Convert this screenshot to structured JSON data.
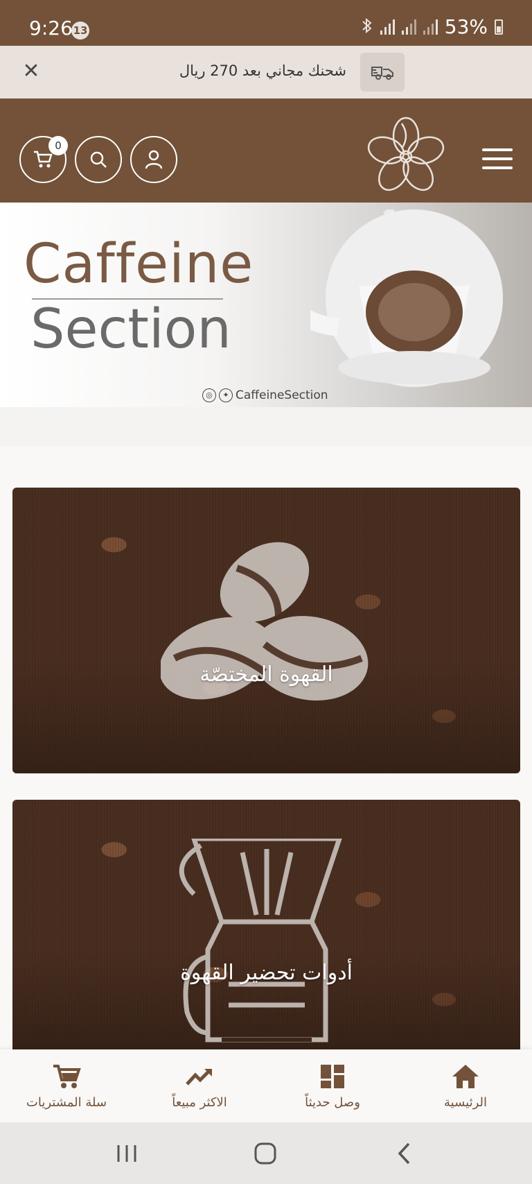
{
  "status_bar": {
    "time": "9:26",
    "notification_count": "13",
    "battery": "53%"
  },
  "announcement": {
    "text": "شحنك مجاني بعد 270 ريال",
    "close_symbol": "✕"
  },
  "header": {
    "cart_count": "0"
  },
  "banner": {
    "brand_line1": "Caffeine",
    "brand_line2": "Section",
    "social_handle": "CaffeineSection"
  },
  "categories": [
    {
      "title": "القهوة المختصّة",
      "icon": "coffee-beans-icon"
    },
    {
      "title": "أدوات تحضير القهوة",
      "icon": "coffee-dripper-icon"
    }
  ],
  "bottom_nav": {
    "items": [
      {
        "label": "سلة المشتريات",
        "icon": "cart-icon"
      },
      {
        "label": "الاكثر مبيعاً",
        "icon": "trending-icon"
      },
      {
        "label": "وصل حديثاً",
        "icon": "dashboard-icon"
      },
      {
        "label": "الرئيسية",
        "icon": "home-icon"
      }
    ]
  },
  "colors": {
    "brand_brown": "#735239",
    "announce_bg": "#e9e2dc",
    "nav_bg": "#f9f8f7"
  }
}
